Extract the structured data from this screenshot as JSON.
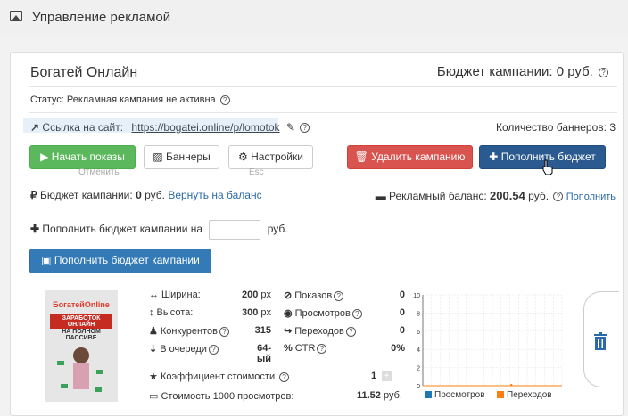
{
  "header": {
    "title": "Управление рекламой"
  },
  "campaign": {
    "name": "Богатей Онлайн",
    "budget_header": "Бюджет кампании: 0 руб.",
    "status": "Статус: Рекламная кампания не активна",
    "link_label": "Ссылка на сайт:",
    "link_url": "https://bogatei.online/p/lomotok",
    "banners_count": "Количество баннеров: 3"
  },
  "buttons": {
    "start": "Начать показы",
    "banners": "Баннеры",
    "settings": "Настройки",
    "delete": "Удалить кампанию",
    "topup": "Пополнить бюджет",
    "topup_campaign": "Пополнить бюджет кампании"
  },
  "overlay": {
    "cancel": "Отменить",
    "esc": "Esc"
  },
  "budget_row": {
    "label": "Бюджет кампании:",
    "value": "0",
    "unit": "руб.",
    "return_link": "Вернуть на баланс",
    "ad_balance_label": "Рекламный баланс:",
    "ad_balance_value": "200.54",
    "ad_balance_unit": "руб.",
    "topup_link": "Пополнить"
  },
  "topup_row": {
    "label": "Пополнить бюджет кампании на",
    "unit": "руб.",
    "input_value": ""
  },
  "banner": {
    "thumb_logo": "БогатейOnline",
    "thumb_line1": "ЗАРАБОТОК ОНЛАЙН",
    "thumb_line2": "НА ПОЛНОМ ПАССИВЕ",
    "stats_left": [
      {
        "icon": "width-icon",
        "label": "Ширина:",
        "value": "200",
        "unit": "px"
      },
      {
        "icon": "height-icon",
        "label": "Высота:",
        "value": "300",
        "unit": "px"
      },
      {
        "icon": "competitors-icon",
        "label": "Конкурентов",
        "value": "315",
        "unit": "",
        "help": true
      },
      {
        "icon": "queue-icon",
        "label": "В очереди",
        "value": "64-ый",
        "unit": "",
        "help": true
      }
    ],
    "stats_right": [
      {
        "icon": "eye-slash-icon",
        "label": "Показов",
        "value": "0"
      },
      {
        "icon": "eye-icon",
        "label": "Просмотров",
        "value": "0"
      },
      {
        "icon": "share-icon",
        "label": "Переходов",
        "value": "0"
      },
      {
        "icon": "percent-icon",
        "label": "CTR",
        "value": "0%"
      }
    ],
    "coef_label": "Коэффициент стоимости",
    "coef_value": "1",
    "cost_label": "Стоимость 1000 просмотров:",
    "cost_value": "11.52",
    "cost_unit": "руб."
  },
  "chart_data": {
    "type": "line",
    "ylim": [
      0,
      10
    ],
    "yticks": [
      "10",
      "8",
      "6",
      "4",
      "2",
      "0"
    ],
    "series": [
      {
        "name": "Просмотров",
        "color": "#1f77b4",
        "values": [
          0,
          0,
          0,
          0,
          0,
          0,
          0,
          0,
          0,
          0,
          0,
          0,
          0,
          0
        ]
      },
      {
        "name": "Переходов",
        "color": "#ff7f0e",
        "values": [
          0,
          0,
          0,
          0,
          0,
          0,
          0,
          0,
          0,
          0,
          0,
          0,
          0,
          0
        ]
      }
    ],
    "grid": true
  },
  "colors": {
    "green": "#5cb85c",
    "red": "#d9534f",
    "navy": "#2a5a8f",
    "blue": "#337ab7"
  },
  "icons": {
    "trash": "trash-icon"
  }
}
